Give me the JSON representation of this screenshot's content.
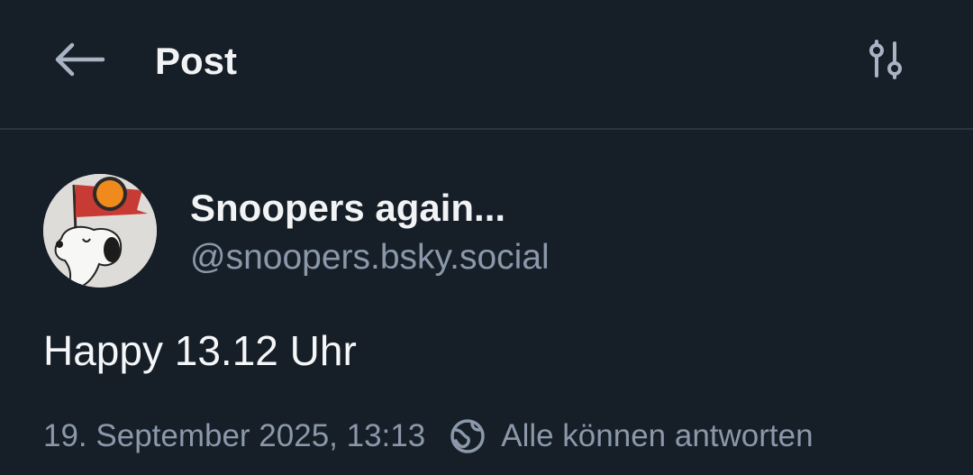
{
  "header": {
    "title": "Post",
    "back_icon": "arrow-left-icon",
    "settings_icon": "sliders-icon"
  },
  "author": {
    "display_name": "Snoopers again...",
    "handle": "@snoopers.bsky.social",
    "avatar": "snoopy-with-flag-avatar"
  },
  "post": {
    "text": "Happy 13.12 Uhr",
    "timestamp": "19. September 2025, 13:13",
    "reply_icon": "globe-icon",
    "reply_setting": "Alle können antworten"
  },
  "colors": {
    "background": "#161e27",
    "divider": "#2b3441",
    "primary_text": "#f1f3f5",
    "secondary_text": "#8a98aa"
  }
}
